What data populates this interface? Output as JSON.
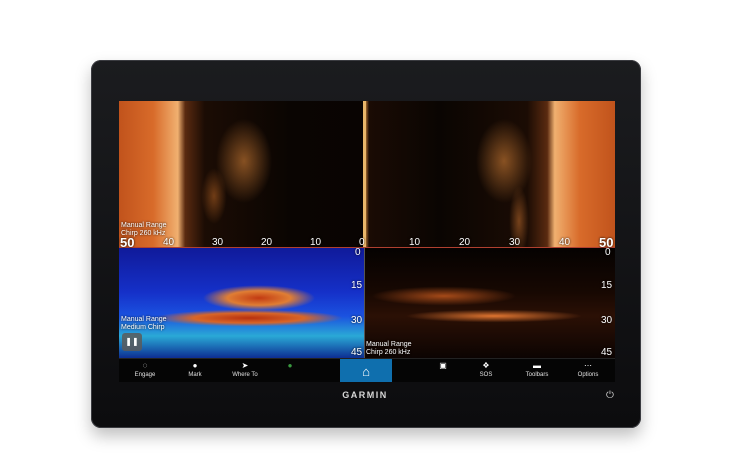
{
  "device": {
    "brand": "GARMIN"
  },
  "panes": {
    "top_left": {
      "range_mode": "Manual Range",
      "frequency": "Chirp 260 kHz",
      "scale": [
        "50",
        "40",
        "30",
        "20",
        "10",
        "0"
      ]
    },
    "top_right": {
      "scale": [
        "10",
        "20",
        "30",
        "40",
        "50"
      ]
    },
    "bottom_left": {
      "range_mode": "Manual Range",
      "frequency": "Medium Chirp",
      "depth": [
        "0",
        "15",
        "30",
        "45"
      ],
      "pause_icon": "pause-icon"
    },
    "bottom_right": {
      "range_mode": "Manual Range",
      "frequency": "Chirp 260 kHz",
      "depth": [
        "0",
        "15",
        "30",
        "45"
      ]
    }
  },
  "toolbar": {
    "items": [
      {
        "label": "Engage",
        "icon": "autopilot-icon"
      },
      {
        "label": "Mark",
        "icon": "pin-icon"
      },
      {
        "label": "Where To",
        "icon": "navigate-arrow-icon"
      },
      {
        "label": "",
        "icon": "globe-icon"
      },
      {
        "label": "",
        "icon": "home-icon"
      },
      {
        "label": "",
        "icon": "screens-icon"
      },
      {
        "label": "SOS",
        "icon": "sos-icon"
      },
      {
        "label": "Toolbars",
        "icon": "toolbars-icon"
      },
      {
        "label": "Options",
        "icon": "options-icon"
      }
    ]
  },
  "colors": {
    "home_button": "#0f6fae",
    "divider": "#e9b66a",
    "sonar_orange": "#d86b2a",
    "sonar_blue": "#1530c8"
  }
}
